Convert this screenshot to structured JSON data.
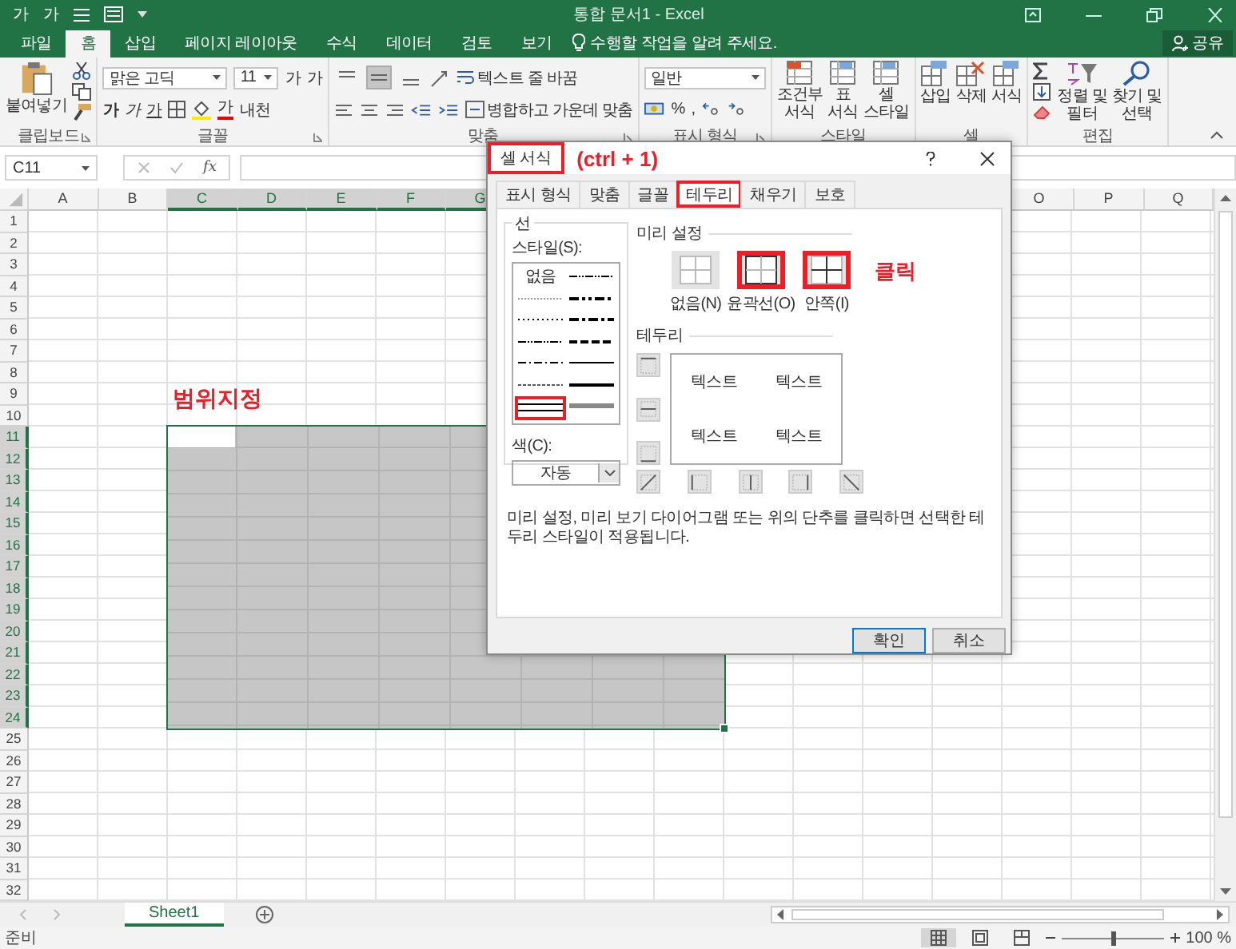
{
  "window": {
    "quick_access": [
      "가",
      "가"
    ],
    "title": "통합 문서1 - Excel"
  },
  "tabs": [
    {
      "label": "파일",
      "selected": false
    },
    {
      "label": "홈",
      "selected": true
    },
    {
      "label": "삽입",
      "selected": false
    },
    {
      "label": "페이지 레이아웃",
      "selected": false
    },
    {
      "label": "수식",
      "selected": false
    },
    {
      "label": "데이터",
      "selected": false
    },
    {
      "label": "검토",
      "selected": false
    },
    {
      "label": "보기",
      "selected": false
    }
  ],
  "tell_me": "수행할 작업을 알려 주세요.",
  "share": "공유",
  "ribbon": {
    "clipboard": {
      "label": "클립보드",
      "paste": "붙여넣기"
    },
    "font": {
      "label": "글꼴",
      "font": "맑은 고딕",
      "size": "11",
      "grow": "가",
      "shrink": "가",
      "bold": "가",
      "italic": "가",
      "underline": "가",
      "font_color": "가",
      "phonetic": "내천"
    },
    "alignment": {
      "label": "맞춤",
      "vertical": [
        {
          "selected": false
        },
        {
          "selected": true
        },
        {
          "selected": false
        }
      ],
      "wrap": "텍스트 줄 바꿈",
      "merge": "병합하고 가운데 맞춤"
    },
    "number": {
      "label": "표시 형식",
      "format": "일반",
      "percent": "%",
      "comma": ","
    },
    "styles": {
      "label": "스타일",
      "buttons": [
        "조건부\n서식",
        "표\n서식",
        "셀\n스타일"
      ]
    },
    "cells": {
      "label": "셀",
      "buttons": [
        "삽입",
        "삭제",
        "서식"
      ]
    },
    "editing": {
      "label": "편집",
      "buttons": [
        "정렬 및\n필터",
        "찾기 및\n선택"
      ]
    }
  },
  "formula_bar": {
    "name_box": "C11",
    "function_label": "fx"
  },
  "sheet": {
    "annotation": "범위지정",
    "columns_left": [
      {
        "label": "A",
        "selected": false
      },
      {
        "label": "B",
        "selected": false
      },
      {
        "label": "C",
        "selected": true
      },
      {
        "label": "D",
        "selected": true
      },
      {
        "label": "E",
        "selected": true
      },
      {
        "label": "F",
        "selected": true
      },
      {
        "label": "G",
        "selected": true
      }
    ],
    "columns_right": [
      {
        "label": "O",
        "selected": false
      },
      {
        "label": "P",
        "selected": false
      },
      {
        "label": "Q",
        "selected": false
      }
    ],
    "rows": [
      {
        "label": "1",
        "selected": false
      },
      {
        "label": "2",
        "selected": false
      },
      {
        "label": "3",
        "selected": false
      },
      {
        "label": "4",
        "selected": false
      },
      {
        "label": "5",
        "selected": false
      },
      {
        "label": "6",
        "selected": false
      },
      {
        "label": "7",
        "selected": false
      },
      {
        "label": "8",
        "selected": false
      },
      {
        "label": "9",
        "selected": false
      },
      {
        "label": "10",
        "selected": false
      },
      {
        "label": "11",
        "selected": true
      },
      {
        "label": "12",
        "selected": true
      },
      {
        "label": "13",
        "selected": true
      },
      {
        "label": "14",
        "selected": true
      },
      {
        "label": "15",
        "selected": true
      },
      {
        "label": "16",
        "selected": true
      },
      {
        "label": "17",
        "selected": true
      },
      {
        "label": "18",
        "selected": true
      },
      {
        "label": "19",
        "selected": true
      },
      {
        "label": "20",
        "selected": true
      },
      {
        "label": "21",
        "selected": true
      },
      {
        "label": "22",
        "selected": true
      },
      {
        "label": "23",
        "selected": true
      },
      {
        "label": "24",
        "selected": true
      },
      {
        "label": "25",
        "selected": false
      },
      {
        "label": "26",
        "selected": false
      },
      {
        "label": "27",
        "selected": false
      },
      {
        "label": "28",
        "selected": false
      },
      {
        "label": "29",
        "selected": false
      },
      {
        "label": "30",
        "selected": false
      },
      {
        "label": "31",
        "selected": false
      },
      {
        "label": "32",
        "selected": false
      }
    ]
  },
  "sheet_tabs": [
    {
      "label": "Sheet1",
      "selected": true
    }
  ],
  "status_bar": {
    "status": "준비",
    "zoom": {
      "level": 0.5
    },
    "zoom_label": "100 %"
  },
  "dialog": {
    "title": "셀 서식",
    "title_highlighted": true,
    "title_annotation": "(ctrl + 1)",
    "tabs": [
      {
        "label": "표시 형식",
        "selected": false,
        "highlighted": false
      },
      {
        "label": "맞춤",
        "selected": false,
        "highlighted": false
      },
      {
        "label": "글꼴",
        "selected": false,
        "highlighted": false
      },
      {
        "label": "테두리",
        "selected": true,
        "highlighted": true
      },
      {
        "label": "채우기",
        "selected": false,
        "highlighted": false
      },
      {
        "label": "보호",
        "selected": false,
        "highlighted": false
      }
    ],
    "line_group": "선",
    "style_label": "스타일(S):",
    "styles": [
      {
        "kind": "none",
        "label": "없음",
        "highlighted": false
      },
      {
        "kind": "dashdotdot",
        "highlighted": false
      },
      {
        "kind": "hair",
        "highlighted": false
      },
      {
        "kind": "mdashdotdot",
        "highlighted": false
      },
      {
        "kind": "dotted",
        "highlighted": false
      },
      {
        "kind": "mdashdot",
        "highlighted": false
      },
      {
        "kind": "dashdotdot",
        "highlighted": false
      },
      {
        "kind": "mdashed",
        "highlighted": false
      },
      {
        "kind": "dashdot",
        "highlighted": false
      },
      {
        "kind": "thin",
        "highlighted": false
      },
      {
        "kind": "dashed",
        "highlighted": false
      },
      {
        "kind": "medium",
        "highlighted": false
      },
      {
        "kind": "double",
        "highlighted": true
      },
      {
        "kind": "thick",
        "highlighted": false
      }
    ],
    "color_label": "색(C):",
    "color_value": "자동",
    "presets_label": "미리 설정",
    "presets_annotation": "클릭",
    "presets": [
      {
        "kind": "none",
        "label": "없음(N)",
        "highlighted": false
      },
      {
        "kind": "outline",
        "label": "윤곽선(O)",
        "highlighted": true
      },
      {
        "kind": "inside",
        "label": "안쪽(I)",
        "highlighted": true
      }
    ],
    "border_label": "테두리",
    "border_buttons": [
      {
        "kind": "top"
      },
      {
        "kind": "middle"
      },
      {
        "kind": "bottom"
      },
      {
        "kind": "diag-up"
      },
      {
        "kind": "left"
      },
      {
        "kind": "center"
      },
      {
        "kind": "right"
      },
      {
        "kind": "diag-down"
      }
    ],
    "preview_texts": [
      "텍스트",
      "텍스트",
      "텍스트",
      "텍스트"
    ],
    "description": "미리 설정, 미리 보기 다이어그램 또는 위의 단추를 클릭하면 선택한 테두리 스타일이 적용됩니다.",
    "buttons": [
      {
        "label": "확인",
        "kind": "default"
      },
      {
        "label": "취소",
        "kind": "normal"
      }
    ]
  }
}
